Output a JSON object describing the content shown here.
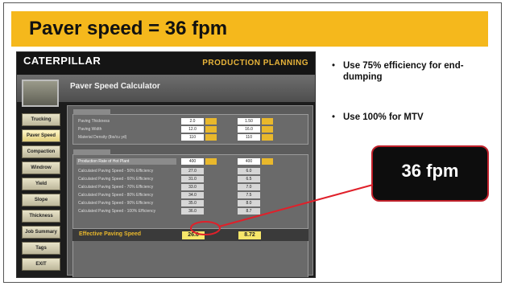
{
  "slide": {
    "title": "Paver speed = 36 fpm",
    "bullets": [
      "Use 75% efficiency for end-dumping",
      "Use 100% for MTV"
    ],
    "callout": "36 fpm",
    "colors": {
      "title_bar": "#f5b81c",
      "callout_border": "#c0202a",
      "highlight": "#e0202a"
    }
  },
  "app": {
    "brand": "CATERPILLAR",
    "header": "PRODUCTION PLANNING",
    "window_title": "Paver Speed Calculator",
    "sidebar": [
      "Trucking",
      "Paver Speed",
      "Compaction",
      "Windrow",
      "Yield",
      "Slope",
      "Thickness",
      "Job Summary",
      "Tags",
      "EXIT"
    ],
    "active_item": "Paver Speed",
    "group1": {
      "rows": [
        {
          "label": "Paving Thickness",
          "v1": "2.0",
          "v2": "1.50"
        },
        {
          "label": "Paving Width",
          "v1": "12.0",
          "v2": "16.0"
        },
        {
          "label": "Material Density (lbs/cu yd)",
          "v1": "110",
          "v2": "110"
        }
      ]
    },
    "group2": {
      "rows": [
        {
          "label": "Production Rate of Hot Plant",
          "v1": "400",
          "v2": "400"
        },
        {
          "label": "Calculated Paving Speed - 50% Efficiency",
          "v1": "27.0",
          "v2": "6.0"
        },
        {
          "label": "Calculated Paving Speed - 60% Efficiency",
          "v1": "31.0",
          "v2": "6.5"
        },
        {
          "label": "Calculated Paving Speed - 70% Efficiency",
          "v1": "33.0",
          "v2": "7.0"
        },
        {
          "label": "Calculated Paving Speed - 80% Efficiency",
          "v1": "34.0",
          "v2": "7.5"
        },
        {
          "label": "Calculated Paving Speed - 90% Efficiency",
          "v1": "35.0",
          "v2": "8.0"
        },
        {
          "label": "Calculated Paving Speed - 100% Efficiency",
          "v1": "36.0",
          "v2": "8.7"
        }
      ]
    },
    "effective": {
      "label": "Effective Paving Speed",
      "v1": "26.6",
      "v2": "8.72"
    }
  }
}
